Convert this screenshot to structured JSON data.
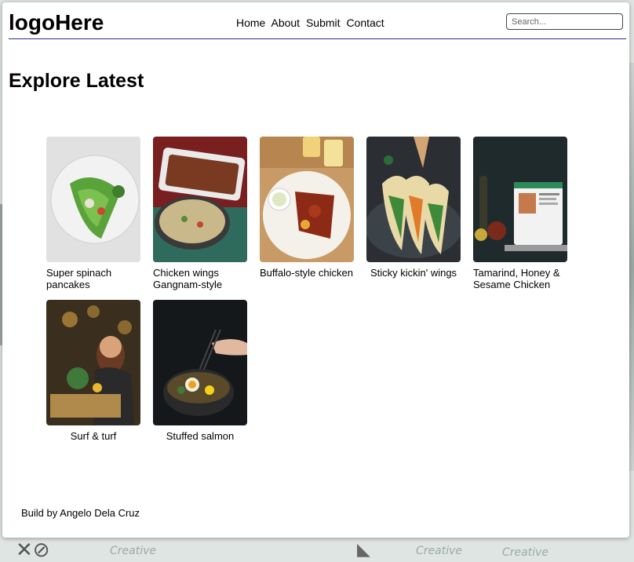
{
  "header": {
    "logo": "logoHere",
    "nav": [
      "Home",
      "About",
      "Submit",
      "Contact"
    ],
    "search_placeholder": "Search..."
  },
  "main": {
    "title": "Explore Latest",
    "recipes": [
      {
        "title": "Super spinach pancakes"
      },
      {
        "title": "Chicken wings Gangnam-style"
      },
      {
        "title": "Buffalo-style chicken"
      },
      {
        "title": "Sticky kickin' wings"
      },
      {
        "title": "Tamarind, Honey & Sesame Chicken"
      },
      {
        "title": "Surf & turf"
      },
      {
        "title": "Stuffed salmon"
      }
    ]
  },
  "footer": {
    "text": "Build by Angelo Dela Cruz"
  }
}
